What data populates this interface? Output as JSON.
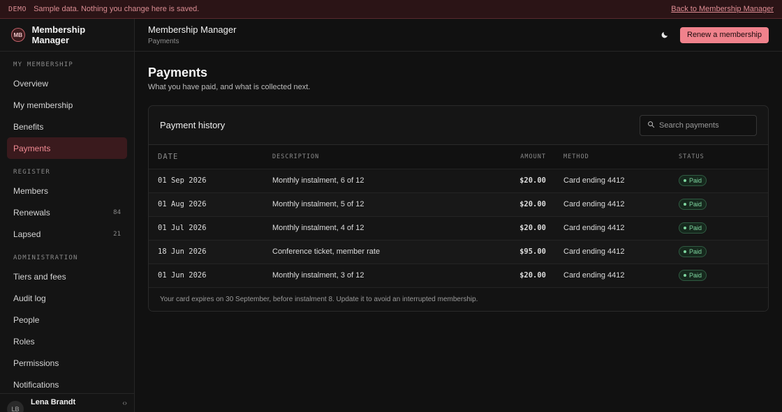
{
  "banner": {
    "tag": "DEMO",
    "text": "Sample data. Nothing you change here is saved.",
    "back_link": "Back to Membership Manager"
  },
  "brand": {
    "logo_initials": "MB",
    "name": "Membership Manager"
  },
  "sidebar": {
    "sections": [
      {
        "label": "MY MEMBERSHIP",
        "items": [
          {
            "label": "Overview",
            "count": "",
            "active": false
          },
          {
            "label": "My membership",
            "count": "",
            "active": false
          },
          {
            "label": "Benefits",
            "count": "",
            "active": false
          },
          {
            "label": "Payments",
            "count": "",
            "active": true
          }
        ]
      },
      {
        "label": "REGISTER",
        "items": [
          {
            "label": "Members",
            "count": "",
            "active": false
          },
          {
            "label": "Renewals",
            "count": "84",
            "active": false
          },
          {
            "label": "Lapsed",
            "count": "21",
            "active": false
          }
        ]
      },
      {
        "label": "ADMINISTRATION",
        "items": [
          {
            "label": "Tiers and fees",
            "count": "",
            "active": false
          },
          {
            "label": "Audit log",
            "count": "",
            "active": false
          },
          {
            "label": "People",
            "count": "",
            "active": false
          },
          {
            "label": "Roles",
            "count": "",
            "active": false
          },
          {
            "label": "Permissions",
            "count": "",
            "active": false
          },
          {
            "label": "Notifications",
            "count": "",
            "active": false
          }
        ]
      }
    ],
    "user": {
      "initials": "LB",
      "name": "Lena Brandt"
    }
  },
  "topbar": {
    "title": "Membership Manager",
    "breadcrumb": "Payments",
    "theme_icon": "moon-icon",
    "primary_button": "Renew a membership"
  },
  "page": {
    "title": "Payments",
    "subtitle": "What you have paid, and what is collected next."
  },
  "payments": {
    "card_title": "Payment history",
    "search_placeholder": "Search payments",
    "columns": {
      "date": "DATE",
      "description": "DESCRIPTION",
      "amount": "AMOUNT",
      "method": "METHOD",
      "status": "STATUS"
    },
    "rows": [
      {
        "date": "01 Sep 2026",
        "description": "Monthly instalment, 6 of 12",
        "amount": "$20.00",
        "method": "Card ending 4412",
        "status": "Paid"
      },
      {
        "date": "01 Aug 2026",
        "description": "Monthly instalment, 5 of 12",
        "amount": "$20.00",
        "method": "Card ending 4412",
        "status": "Paid"
      },
      {
        "date": "01 Jul 2026",
        "description": "Monthly instalment, 4 of 12",
        "amount": "$20.00",
        "method": "Card ending 4412",
        "status": "Paid"
      },
      {
        "date": "18 Jun 2026",
        "description": "Conference ticket, member rate",
        "amount": "$95.00",
        "method": "Card ending 4412",
        "status": "Paid"
      },
      {
        "date": "01 Jun 2026",
        "description": "Monthly instalment, 3 of 12",
        "amount": "$20.00",
        "method": "Card ending 4412",
        "status": "Paid"
      }
    ],
    "footer_note": "Your card expires on 30 September, before instalment 8. Update it to avoid an interrupted membership."
  },
  "colors": {
    "accent": "#f0828c",
    "status_paid": "#7fd6a0",
    "banner_bg": "#2b1416"
  }
}
